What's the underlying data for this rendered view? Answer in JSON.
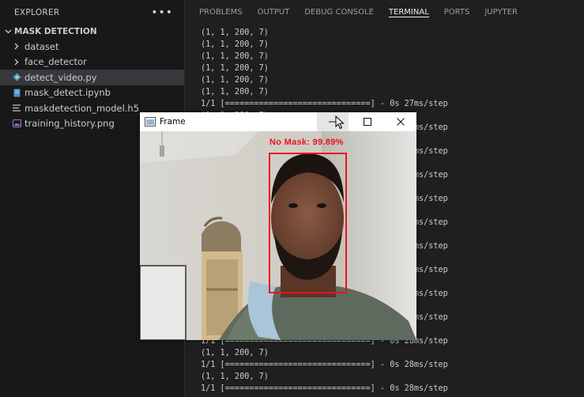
{
  "explorer": {
    "title": "EXPLORER",
    "more": "•••",
    "folder": "MASK DETECTION",
    "items": [
      {
        "label": "dataset",
        "type": "folder",
        "icon": "chevron-right-icon"
      },
      {
        "label": "face_detector",
        "type": "folder",
        "icon": "chevron-right-icon"
      },
      {
        "label": "detect_video.py",
        "type": "file",
        "icon": "python-file-icon",
        "selected": true
      },
      {
        "label": "mask_detect.ipynb",
        "type": "file",
        "icon": "notebook-file-icon"
      },
      {
        "label": "maskdetection_model.h5",
        "type": "file",
        "icon": "lines-file-icon"
      },
      {
        "label": "training_history.png",
        "type": "file",
        "icon": "image-file-icon"
      }
    ]
  },
  "panel": {
    "tabs": [
      {
        "label": "PROBLEMS",
        "active": false
      },
      {
        "label": "OUTPUT",
        "active": false
      },
      {
        "label": "DEBUG CONSOLE",
        "active": false
      },
      {
        "label": "TERMINAL",
        "active": true
      },
      {
        "label": "PORTS",
        "active": false
      },
      {
        "label": "JUPYTER",
        "active": false
      }
    ]
  },
  "terminal": {
    "lines": [
      "(1, 1, 200, 7)",
      "(1, 1, 200, 7)",
      "(1, 1, 200, 7)",
      "(1, 1, 200, 7)",
      "(1, 1, 200, 7)",
      "(1, 1, 200, 7)",
      "1/1 [==============================] - 0s 27ms/step",
      "(1, 1, 200, 7)",
      "1/1 [==============================] - 0s 27ms/step",
      "(1, 1, 200, 7)",
      "1/1 [==============================] - 0s 27ms/step",
      "(1, 1, 200, 7)",
      "1/1 [==============================] - 0s 27ms/step",
      "(1, 1, 200, 7)",
      "1/1 [==============================] - 0s 27ms/step",
      "(1, 1, 200, 7)",
      "1/1 [==============================] - 0s 27ms/step",
      "(1, 1, 200, 7)",
      "1/1 [==============================] - 0s 27ms/step",
      "(1, 1, 200, 7)",
      "1/1 [==============================] - 0s 28ms/step",
      "(1, 1, 200, 7)",
      "1/1 [==============================] - 0s 28ms/step",
      "(1, 1, 200, 7)",
      "1/1 [==============================] - 0s 28ms/step",
      "(1, 1, 200, 7)",
      "1/1 [==============================] - 0s 28ms/step",
      "(1, 1, 200, 7)",
      "1/1 [==============================] - 0s 28ms/step",
      "(1, 1, 200, 7)",
      "1/1 [==============================] - 0s 28ms/step",
      "(1, 1, 200, 7)"
    ]
  },
  "frame_window": {
    "title": "Frame",
    "detection_label": "No Mask: 99.89%",
    "box_color": "#e8141e"
  },
  "colors": {
    "sidebar_bg": "#181818",
    "panel_bg": "#1f1f1f",
    "text": "#cccccc",
    "selection": "#37373d",
    "python_icon": "#4aa3df",
    "notebook_icon": "#4a90d9",
    "image_icon": "#a074c4"
  }
}
